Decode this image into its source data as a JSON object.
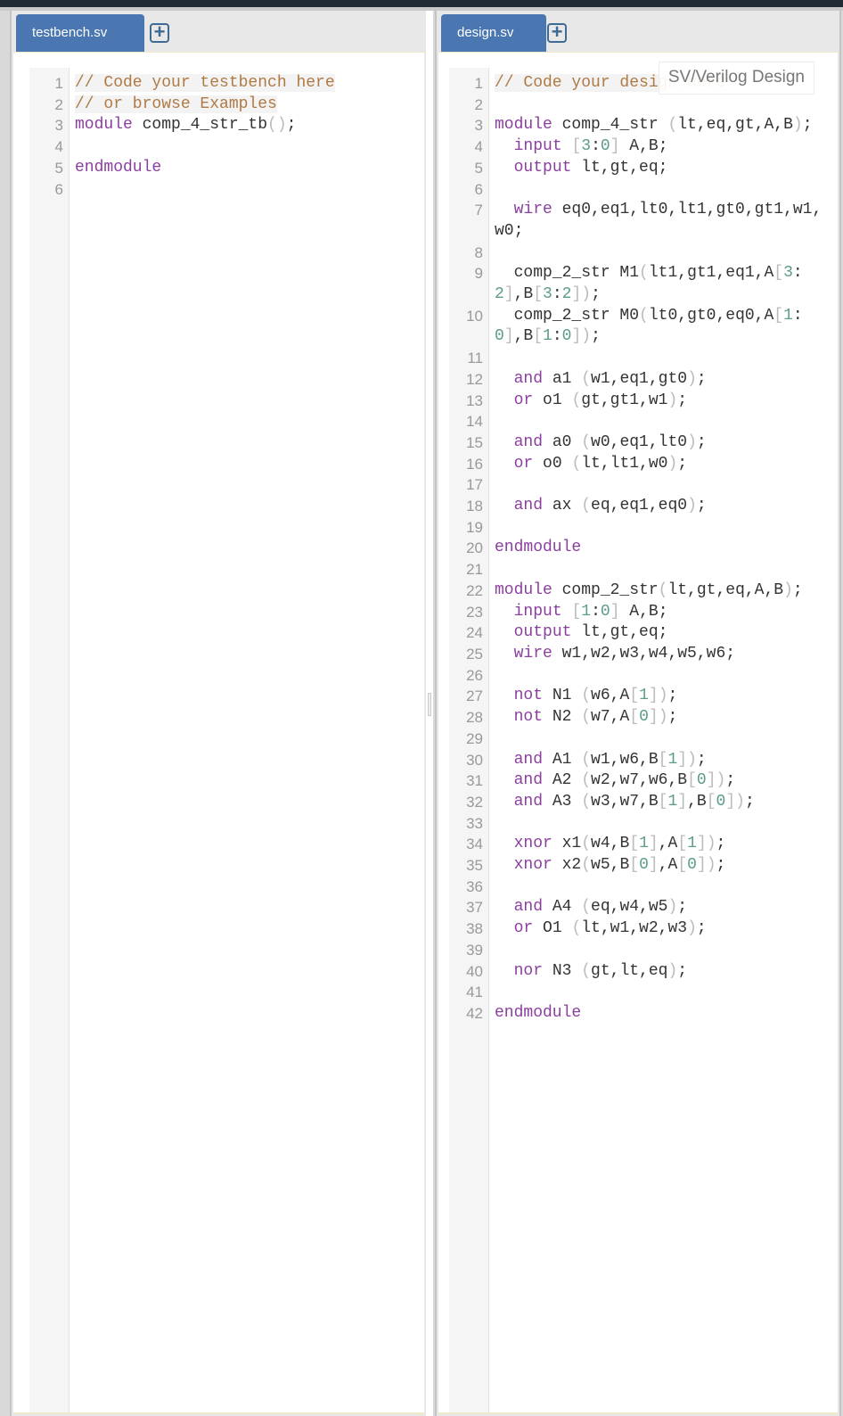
{
  "testbench": {
    "tab_label": "testbench.sv",
    "add_tab_icon": "plus-box-icon",
    "lines": [
      {
        "n": "1",
        "tokens": [
          {
            "t": "// Code your testbench here",
            "c": "cm"
          }
        ]
      },
      {
        "n": "2",
        "tokens": [
          {
            "t": "// or browse Examples",
            "c": "cm"
          }
        ]
      },
      {
        "n": "3",
        "tokens": [
          {
            "t": "module",
            "c": "kw"
          },
          {
            "t": " comp_4_str_tb"
          },
          {
            "t": "()",
            "c": "pn"
          },
          {
            "t": ";"
          }
        ]
      },
      {
        "n": "4",
        "tokens": []
      },
      {
        "n": "5",
        "tokens": [
          {
            "t": "endmodule",
            "c": "kw"
          }
        ]
      },
      {
        "n": "6",
        "tokens": []
      }
    ]
  },
  "design": {
    "tab_label": "design.sv",
    "add_tab_icon": "plus-box-icon",
    "language_tooltip": "SV/Verilog Design",
    "lines": [
      {
        "n": "1",
        "tokens": [
          {
            "t": "// Code your design here",
            "c": "cm"
          }
        ]
      },
      {
        "n": "2",
        "tokens": []
      },
      {
        "n": "3",
        "tokens": [
          {
            "t": "module",
            "c": "kw"
          },
          {
            "t": " comp_4_str "
          },
          {
            "t": "(",
            "c": "pn"
          },
          {
            "t": "lt,eq,gt,A,B"
          },
          {
            "t": ")",
            "c": "pn"
          },
          {
            "t": ";"
          }
        ]
      },
      {
        "n": "4",
        "tokens": [
          {
            "t": "  "
          },
          {
            "t": "input",
            "c": "kw"
          },
          {
            "t": " "
          },
          {
            "t": "[",
            "c": "pn"
          },
          {
            "t": "3",
            "c": "nm"
          },
          {
            "t": ":"
          },
          {
            "t": "0",
            "c": "nm"
          },
          {
            "t": "]",
            "c": "pn"
          },
          {
            "t": " A,B;"
          }
        ]
      },
      {
        "n": "5",
        "tokens": [
          {
            "t": "  "
          },
          {
            "t": "output",
            "c": "kw"
          },
          {
            "t": " lt,gt,eq;"
          }
        ]
      },
      {
        "n": "6",
        "tokens": []
      },
      {
        "n": "7",
        "tokens": [
          {
            "t": "  "
          },
          {
            "t": "wire",
            "c": "kw"
          },
          {
            "t": " eq0,eq1,lt0,lt1,gt0,gt1,w1,w0;"
          }
        ]
      },
      {
        "n": "8",
        "tokens": []
      },
      {
        "n": "9",
        "tokens": [
          {
            "t": "  comp_2_str M1"
          },
          {
            "t": "(",
            "c": "pn"
          },
          {
            "t": "lt1,gt1,eq1,A"
          },
          {
            "t": "[",
            "c": "pn"
          },
          {
            "t": "3",
            "c": "nm"
          },
          {
            "t": ":"
          },
          {
            "t": "2",
            "c": "nm"
          },
          {
            "t": "]",
            "c": "pn"
          },
          {
            "t": ",B"
          },
          {
            "t": "[",
            "c": "pn"
          },
          {
            "t": "3",
            "c": "nm"
          },
          {
            "t": ":"
          },
          {
            "t": "2",
            "c": "nm"
          },
          {
            "t": "])",
            "c": "pn"
          },
          {
            "t": ";"
          }
        ]
      },
      {
        "n": "10",
        "tokens": [
          {
            "t": "  comp_2_str M0"
          },
          {
            "t": "(",
            "c": "pn"
          },
          {
            "t": "lt0,gt0,eq0,A"
          },
          {
            "t": "[",
            "c": "pn"
          },
          {
            "t": "1",
            "c": "nm"
          },
          {
            "t": ":"
          },
          {
            "t": "0",
            "c": "nm"
          },
          {
            "t": "]",
            "c": "pn"
          },
          {
            "t": ",B"
          },
          {
            "t": "[",
            "c": "pn"
          },
          {
            "t": "1",
            "c": "nm"
          },
          {
            "t": ":"
          },
          {
            "t": "0",
            "c": "nm"
          },
          {
            "t": "])",
            "c": "pn"
          },
          {
            "t": ";"
          }
        ]
      },
      {
        "n": "11",
        "tokens": []
      },
      {
        "n": "12",
        "tokens": [
          {
            "t": "  "
          },
          {
            "t": "and",
            "c": "kw"
          },
          {
            "t": " a1 "
          },
          {
            "t": "(",
            "c": "pn"
          },
          {
            "t": "w1,eq1,gt0"
          },
          {
            "t": ")",
            "c": "pn"
          },
          {
            "t": ";"
          }
        ]
      },
      {
        "n": "13",
        "tokens": [
          {
            "t": "  "
          },
          {
            "t": "or",
            "c": "kw"
          },
          {
            "t": " o1 "
          },
          {
            "t": "(",
            "c": "pn"
          },
          {
            "t": "gt,gt1,w1"
          },
          {
            "t": ")",
            "c": "pn"
          },
          {
            "t": ";"
          }
        ]
      },
      {
        "n": "14",
        "tokens": []
      },
      {
        "n": "15",
        "tokens": [
          {
            "t": "  "
          },
          {
            "t": "and",
            "c": "kw"
          },
          {
            "t": " a0 "
          },
          {
            "t": "(",
            "c": "pn"
          },
          {
            "t": "w0,eq1,lt0"
          },
          {
            "t": ")",
            "c": "pn"
          },
          {
            "t": ";"
          }
        ]
      },
      {
        "n": "16",
        "tokens": [
          {
            "t": "  "
          },
          {
            "t": "or",
            "c": "kw"
          },
          {
            "t": " o0 "
          },
          {
            "t": "(",
            "c": "pn"
          },
          {
            "t": "lt,lt1,w0"
          },
          {
            "t": ")",
            "c": "pn"
          },
          {
            "t": ";"
          }
        ]
      },
      {
        "n": "17",
        "tokens": []
      },
      {
        "n": "18",
        "tokens": [
          {
            "t": "  "
          },
          {
            "t": "and",
            "c": "kw"
          },
          {
            "t": " ax "
          },
          {
            "t": "(",
            "c": "pn"
          },
          {
            "t": "eq,eq1,eq0"
          },
          {
            "t": ")",
            "c": "pn"
          },
          {
            "t": ";"
          }
        ]
      },
      {
        "n": "19",
        "tokens": []
      },
      {
        "n": "20",
        "tokens": [
          {
            "t": "endmodule",
            "c": "kw"
          }
        ]
      },
      {
        "n": "21",
        "tokens": []
      },
      {
        "n": "22",
        "tokens": [
          {
            "t": "module",
            "c": "kw"
          },
          {
            "t": " comp_2_str"
          },
          {
            "t": "(",
            "c": "pn"
          },
          {
            "t": "lt,gt,eq,A,B"
          },
          {
            "t": ")",
            "c": "pn"
          },
          {
            "t": ";"
          }
        ]
      },
      {
        "n": "23",
        "tokens": [
          {
            "t": "  "
          },
          {
            "t": "input",
            "c": "kw"
          },
          {
            "t": " "
          },
          {
            "t": "[",
            "c": "pn"
          },
          {
            "t": "1",
            "c": "nm"
          },
          {
            "t": ":"
          },
          {
            "t": "0",
            "c": "nm"
          },
          {
            "t": "]",
            "c": "pn"
          },
          {
            "t": " A,B;"
          }
        ]
      },
      {
        "n": "24",
        "tokens": [
          {
            "t": "  "
          },
          {
            "t": "output",
            "c": "kw"
          },
          {
            "t": " lt,gt,eq;"
          }
        ]
      },
      {
        "n": "25",
        "tokens": [
          {
            "t": "  "
          },
          {
            "t": "wire",
            "c": "kw"
          },
          {
            "t": " w1,w2,w3,w4,w5,w6;"
          }
        ]
      },
      {
        "n": "26",
        "tokens": []
      },
      {
        "n": "27",
        "tokens": [
          {
            "t": "  "
          },
          {
            "t": "not",
            "c": "kw"
          },
          {
            "t": " N1 "
          },
          {
            "t": "(",
            "c": "pn"
          },
          {
            "t": "w6,A"
          },
          {
            "t": "[",
            "c": "pn"
          },
          {
            "t": "1",
            "c": "nm"
          },
          {
            "t": "])",
            "c": "pn"
          },
          {
            "t": ";"
          }
        ]
      },
      {
        "n": "28",
        "tokens": [
          {
            "t": "  "
          },
          {
            "t": "not",
            "c": "kw"
          },
          {
            "t": " N2 "
          },
          {
            "t": "(",
            "c": "pn"
          },
          {
            "t": "w7,A"
          },
          {
            "t": "[",
            "c": "pn"
          },
          {
            "t": "0",
            "c": "nm"
          },
          {
            "t": "])",
            "c": "pn"
          },
          {
            "t": ";"
          }
        ]
      },
      {
        "n": "29",
        "tokens": []
      },
      {
        "n": "30",
        "tokens": [
          {
            "t": "  "
          },
          {
            "t": "and",
            "c": "kw"
          },
          {
            "t": " A1 "
          },
          {
            "t": "(",
            "c": "pn"
          },
          {
            "t": "w1,w6,B"
          },
          {
            "t": "[",
            "c": "pn"
          },
          {
            "t": "1",
            "c": "nm"
          },
          {
            "t": "])",
            "c": "pn"
          },
          {
            "t": ";"
          }
        ]
      },
      {
        "n": "31",
        "tokens": [
          {
            "t": "  "
          },
          {
            "t": "and",
            "c": "kw"
          },
          {
            "t": " A2 "
          },
          {
            "t": "(",
            "c": "pn"
          },
          {
            "t": "w2,w7,w6,B"
          },
          {
            "t": "[",
            "c": "pn"
          },
          {
            "t": "0",
            "c": "nm"
          },
          {
            "t": "])",
            "c": "pn"
          },
          {
            "t": ";"
          }
        ]
      },
      {
        "n": "32",
        "tokens": [
          {
            "t": "  "
          },
          {
            "t": "and",
            "c": "kw"
          },
          {
            "t": " A3 "
          },
          {
            "t": "(",
            "c": "pn"
          },
          {
            "t": "w3,w7,B"
          },
          {
            "t": "[",
            "c": "pn"
          },
          {
            "t": "1",
            "c": "nm"
          },
          {
            "t": "]",
            "c": "pn"
          },
          {
            "t": ",B"
          },
          {
            "t": "[",
            "c": "pn"
          },
          {
            "t": "0",
            "c": "nm"
          },
          {
            "t": "])",
            "c": "pn"
          },
          {
            "t": ";"
          }
        ]
      },
      {
        "n": "33",
        "tokens": []
      },
      {
        "n": "34",
        "tokens": [
          {
            "t": "  "
          },
          {
            "t": "xnor",
            "c": "kw"
          },
          {
            "t": " x1"
          },
          {
            "t": "(",
            "c": "pn"
          },
          {
            "t": "w4,B"
          },
          {
            "t": "[",
            "c": "pn"
          },
          {
            "t": "1",
            "c": "nm"
          },
          {
            "t": "]",
            "c": "pn"
          },
          {
            "t": ",A"
          },
          {
            "t": "[",
            "c": "pn"
          },
          {
            "t": "1",
            "c": "nm"
          },
          {
            "t": "])",
            "c": "pn"
          },
          {
            "t": ";"
          }
        ]
      },
      {
        "n": "35",
        "tokens": [
          {
            "t": "  "
          },
          {
            "t": "xnor",
            "c": "kw"
          },
          {
            "t": " x2"
          },
          {
            "t": "(",
            "c": "pn"
          },
          {
            "t": "w5,B"
          },
          {
            "t": "[",
            "c": "pn"
          },
          {
            "t": "0",
            "c": "nm"
          },
          {
            "t": "]",
            "c": "pn"
          },
          {
            "t": ",A"
          },
          {
            "t": "[",
            "c": "pn"
          },
          {
            "t": "0",
            "c": "nm"
          },
          {
            "t": "])",
            "c": "pn"
          },
          {
            "t": ";"
          }
        ]
      },
      {
        "n": "36",
        "tokens": []
      },
      {
        "n": "37",
        "tokens": [
          {
            "t": "  "
          },
          {
            "t": "and",
            "c": "kw"
          },
          {
            "t": " A4 "
          },
          {
            "t": "(",
            "c": "pn"
          },
          {
            "t": "eq,w4,w5"
          },
          {
            "t": ")",
            "c": "pn"
          },
          {
            "t": ";"
          }
        ]
      },
      {
        "n": "38",
        "tokens": [
          {
            "t": "  "
          },
          {
            "t": "or",
            "c": "kw"
          },
          {
            "t": " O1 "
          },
          {
            "t": "(",
            "c": "pn"
          },
          {
            "t": "lt,w1,w2,w3"
          },
          {
            "t": ")",
            "c": "pn"
          },
          {
            "t": ";"
          }
        ]
      },
      {
        "n": "39",
        "tokens": []
      },
      {
        "n": "40",
        "tokens": [
          {
            "t": "  "
          },
          {
            "t": "nor",
            "c": "kw"
          },
          {
            "t": " N3 "
          },
          {
            "t": "(",
            "c": "pn"
          },
          {
            "t": "gt,lt,eq"
          },
          {
            "t": ")",
            "c": "pn"
          },
          {
            "t": ";"
          }
        ]
      },
      {
        "n": "41",
        "tokens": []
      },
      {
        "n": "42",
        "tokens": [
          {
            "t": "endmodule",
            "c": "kw"
          }
        ]
      }
    ]
  }
}
